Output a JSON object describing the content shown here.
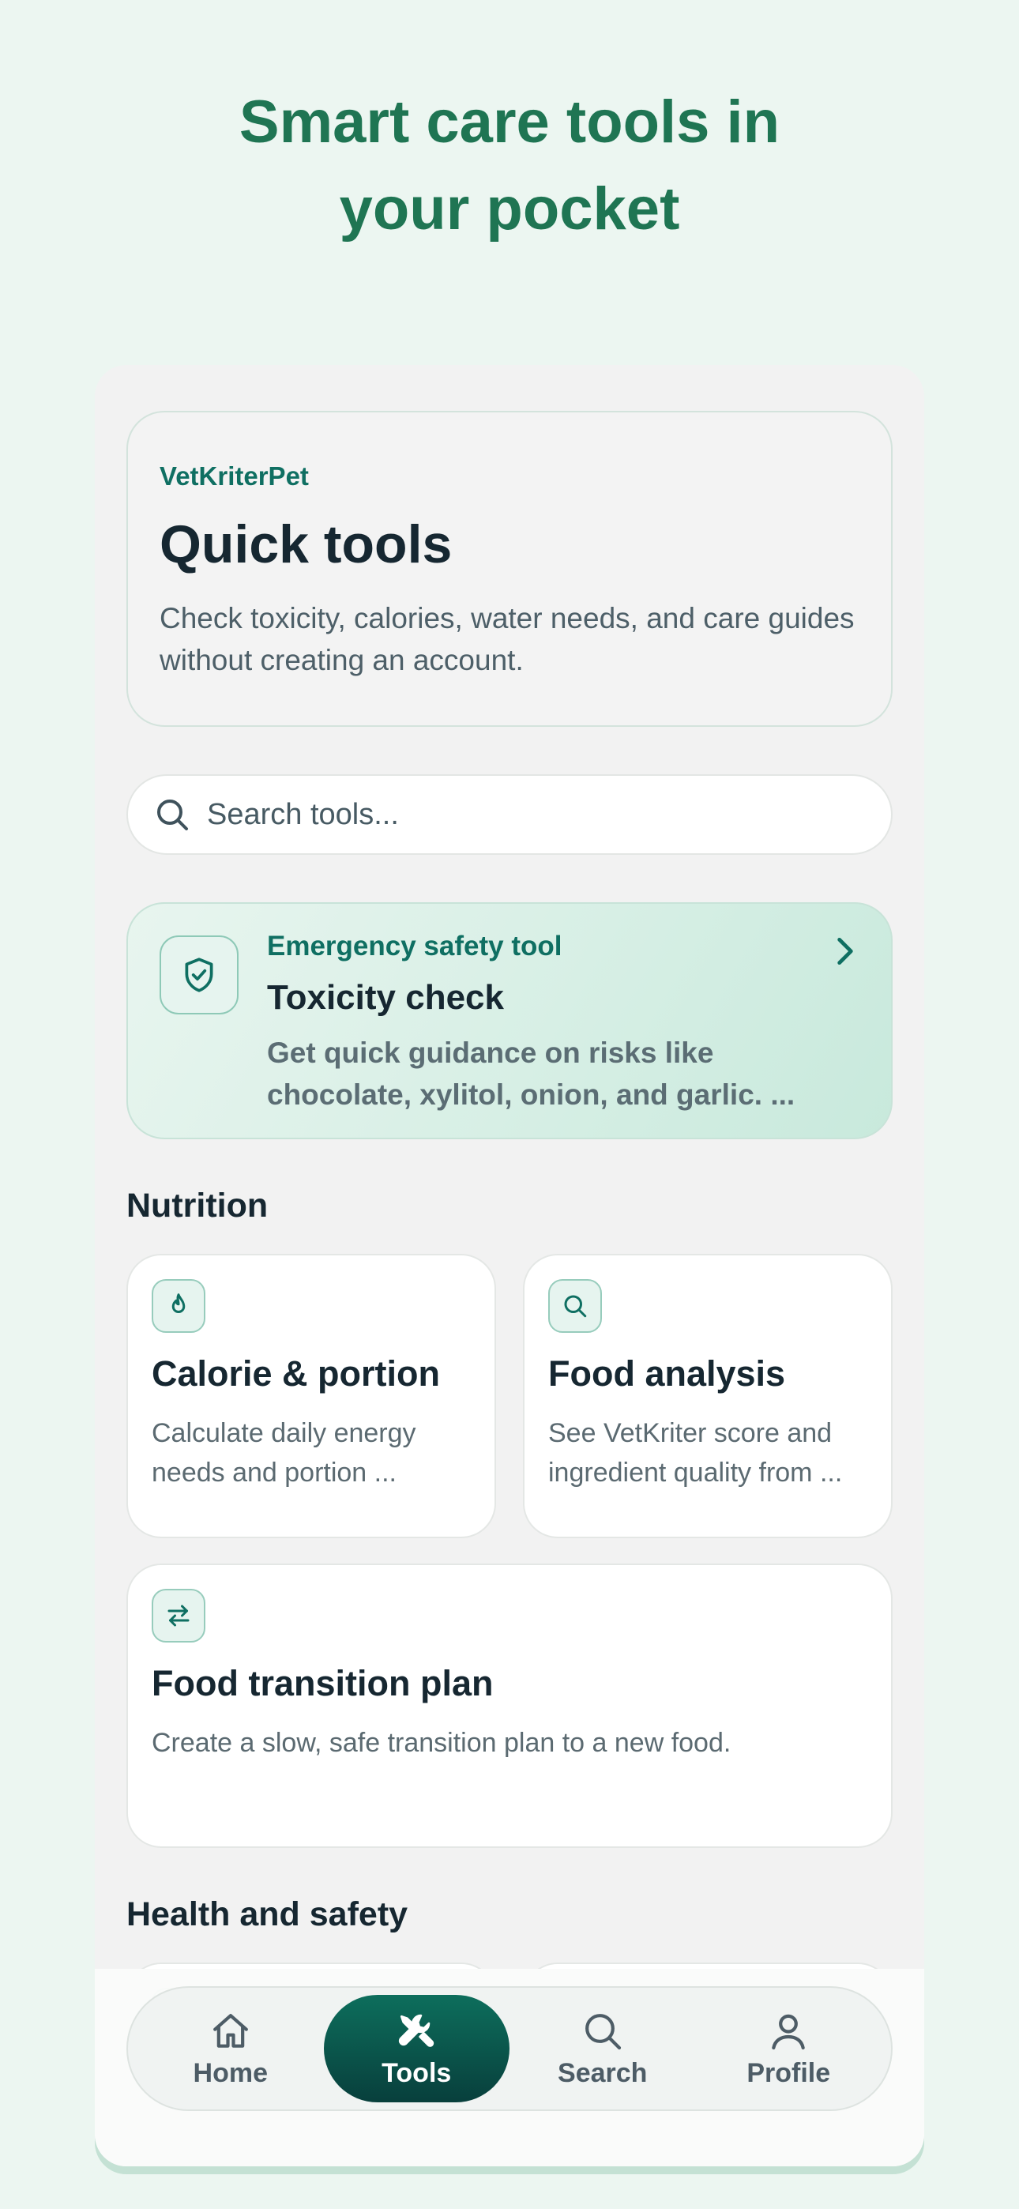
{
  "marketing": {
    "headline_line1": "Smart care tools in",
    "headline_line2": "your pocket"
  },
  "hero": {
    "brand": "VetKriterPet",
    "title": "Quick tools",
    "description": "Check toxicity, calories, water needs, and care guides without creating an account."
  },
  "search": {
    "placeholder": "Search tools..."
  },
  "featured": {
    "kicker": "Emergency safety tool",
    "title": "Toxicity check",
    "description": "Get quick guidance on risks like chocolate, xylitol, onion, and garlic. ...",
    "icon": "shield-check-icon"
  },
  "sections": {
    "nutrition": {
      "title": "Nutrition",
      "cards": [
        {
          "title": "Calorie & portion",
          "description": "Calculate daily energy needs and portion ...",
          "icon": "flame-icon"
        },
        {
          "title": "Food analysis",
          "description": "See VetKriter score and ingredient quality from ...",
          "icon": "search-icon"
        },
        {
          "title": "Food transition plan",
          "description": "Create a slow, safe transition plan to a new food.",
          "icon": "swap-arrows-icon"
        }
      ]
    },
    "health": {
      "title": "Health and safety"
    }
  },
  "tabbar": {
    "items": [
      {
        "label": "Home",
        "icon": "home-icon"
      },
      {
        "label": "Tools",
        "icon": "tools-icon",
        "active": true
      },
      {
        "label": "Search",
        "icon": "search-icon"
      },
      {
        "label": "Profile",
        "icon": "user-icon"
      }
    ]
  },
  "colors": {
    "accent": "#0f6f62",
    "headline": "#1f7553",
    "background": "#ecf6f1"
  }
}
